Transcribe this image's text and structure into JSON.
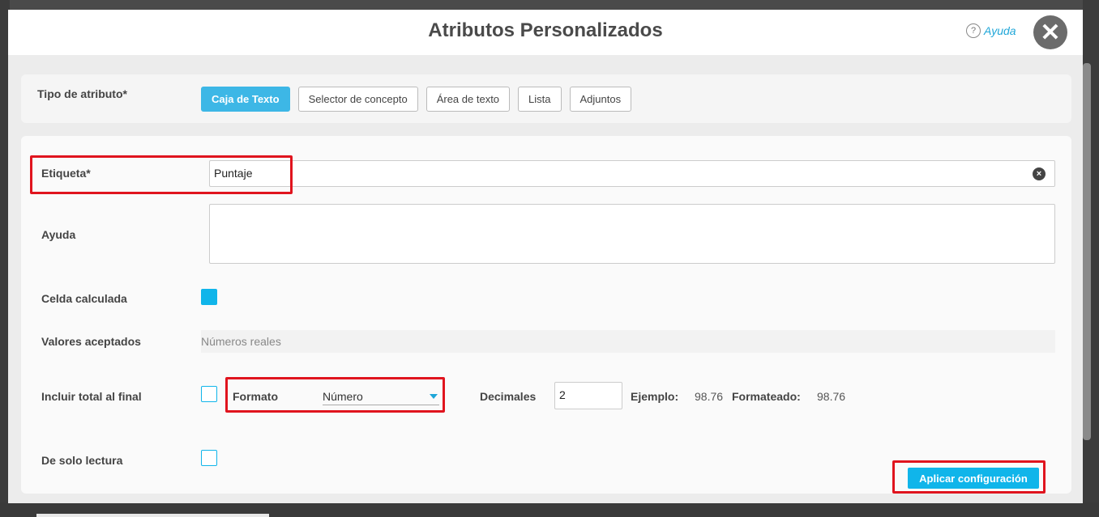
{
  "modal": {
    "title": "Atributos Personalizados",
    "help_label": "Ayuda",
    "help_icon": "?",
    "close_icon": "✕"
  },
  "type_section": {
    "label": "Tipo de atributo*",
    "buttons": [
      {
        "label": "Caja de Texto",
        "active": true
      },
      {
        "label": "Selector de concepto",
        "active": false
      },
      {
        "label": "Área de texto",
        "active": false
      },
      {
        "label": "Lista",
        "active": false
      },
      {
        "label": "Adjuntos",
        "active": false
      }
    ]
  },
  "form": {
    "etiqueta_label": "Etiqueta*",
    "etiqueta_value": "Puntaje",
    "ayuda_label": "Ayuda",
    "celda_label": "Celda calculada",
    "celda_checked": true,
    "valores_label": "Valores aceptados",
    "valores_value": "Números reales",
    "incluir_label": "Incluir total al final",
    "incluir_checked": false,
    "formato_label": "Formato",
    "formato_value": "Número",
    "decimales_label": "Decimales",
    "decimales_value": "2",
    "ejemplo_label": "Ejemplo:",
    "ejemplo_value": "98.76",
    "formateado_label": "Formateado:",
    "formateado_value": "98.76",
    "solo_lectura_label": "De solo lectura",
    "solo_lectura_checked": false,
    "apply_label": "Aplicar configuración"
  },
  "colors": {
    "accent": "#10b5ea",
    "highlight": "#e0141e",
    "close_bg": "#6b6b6b"
  }
}
